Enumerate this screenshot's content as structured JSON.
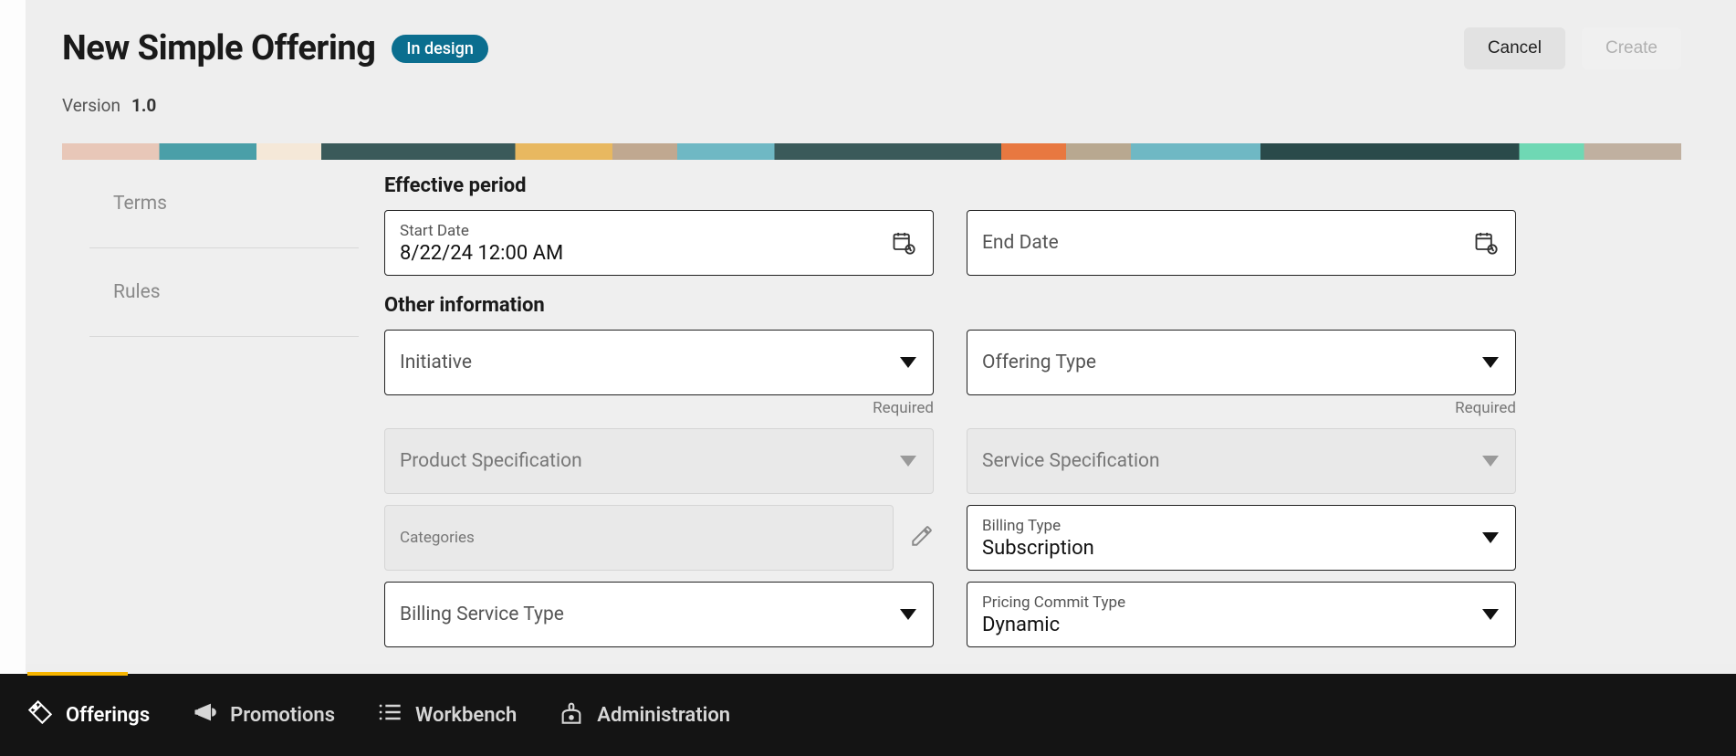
{
  "header": {
    "title": "New Simple Offering",
    "status_badge": "In design",
    "version_label": "Version",
    "version_value": "1.0",
    "cancel_label": "Cancel",
    "create_label": "Create"
  },
  "side_nav": {
    "items": [
      {
        "label": "Terms"
      },
      {
        "label": "Rules"
      }
    ]
  },
  "form": {
    "effective_period": {
      "title": "Effective period",
      "start_date": {
        "label": "Start Date",
        "value": "8/22/24 12:00 AM"
      },
      "end_date": {
        "label": "End Date",
        "value": ""
      }
    },
    "other_info": {
      "title": "Other information",
      "initiative": {
        "label": "Initiative",
        "required_text": "Required"
      },
      "offering_type": {
        "label": "Offering Type",
        "required_text": "Required"
      },
      "product_spec": {
        "label": "Product Specification"
      },
      "service_spec": {
        "label": "Service Specification"
      },
      "categories": {
        "label": "Categories"
      },
      "billing_type": {
        "label": "Billing Type",
        "value": "Subscription"
      },
      "billing_service_type": {
        "label": "Billing Service Type"
      },
      "pricing_commit_type": {
        "label": "Pricing Commit Type",
        "value": "Dynamic"
      }
    }
  },
  "bottom_nav": {
    "items": [
      {
        "label": "Offerings",
        "icon": "tag-icon"
      },
      {
        "label": "Promotions",
        "icon": "megaphone-icon"
      },
      {
        "label": "Workbench",
        "icon": "list-icon"
      },
      {
        "label": "Administration",
        "icon": "lock-icon"
      }
    ]
  }
}
